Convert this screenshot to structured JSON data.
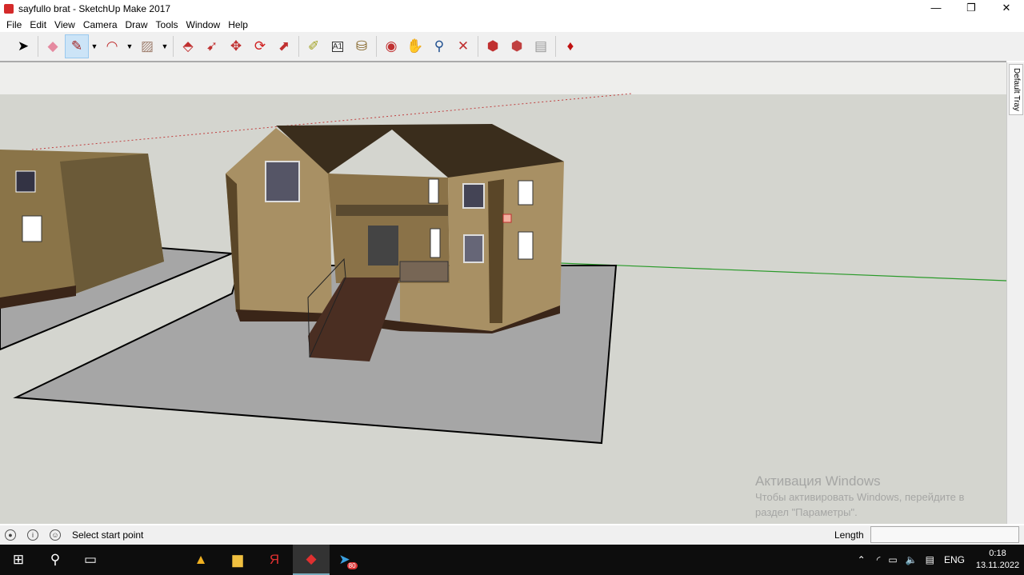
{
  "window": {
    "title": "sayfullo brat - SketchUp Make 2017",
    "minimize": "—",
    "restore": "❐",
    "close": "✕"
  },
  "menu": [
    "File",
    "Edit",
    "View",
    "Camera",
    "Draw",
    "Tools",
    "Window",
    "Help"
  ],
  "toolbar": [
    {
      "name": "select-tool",
      "glyph": "➤",
      "color": "#000"
    },
    {
      "name": "eraser-tool",
      "glyph": "◆",
      "color": "#e58aa0"
    },
    {
      "name": "line-tool",
      "glyph": "✎",
      "color": "#a02020",
      "active": true,
      "dropdown": true
    },
    {
      "name": "arc-tool",
      "glyph": "◠",
      "color": "#c03030",
      "dropdown": true
    },
    {
      "name": "rectangle-tool",
      "glyph": "▨",
      "color": "#a08070",
      "dropdown": true
    },
    {
      "name": "push-pull-tool",
      "glyph": "⬘",
      "color": "#c03030"
    },
    {
      "name": "follow-me-tool",
      "glyph": "➹",
      "color": "#c03030"
    },
    {
      "name": "move-tool",
      "glyph": "✥",
      "color": "#c03030"
    },
    {
      "name": "rotate-tool",
      "glyph": "⟳",
      "color": "#d02020"
    },
    {
      "name": "scale-tool",
      "glyph": "⬈",
      "color": "#c03030"
    },
    {
      "name": "tape-measure-tool",
      "glyph": "✐",
      "color": "#a0a020"
    },
    {
      "name": "text-tool",
      "glyph": "A1",
      "color": "#333"
    },
    {
      "name": "paint-bucket-tool",
      "glyph": "⛁",
      "color": "#806020"
    },
    {
      "name": "orbit-tool",
      "glyph": "◉",
      "color": "#c03030"
    },
    {
      "name": "pan-tool",
      "glyph": "✋",
      "color": "#d0a060"
    },
    {
      "name": "zoom-tool",
      "glyph": "⚲",
      "color": "#205090"
    },
    {
      "name": "zoom-extents-tool",
      "glyph": "✕",
      "color": "#c03030"
    },
    {
      "name": "3d-warehouse",
      "glyph": "⬢",
      "color": "#c03030"
    },
    {
      "name": "extension-warehouse",
      "glyph": "⬢",
      "color": "#c04040"
    },
    {
      "name": "send-to-layout",
      "glyph": "▤",
      "color": "#999"
    },
    {
      "name": "extension-manager",
      "glyph": "♦",
      "color": "#c01010"
    }
  ],
  "tray": {
    "label": "Default Tray"
  },
  "watermark": {
    "title": "Активация Windows",
    "line1": "Чтобы активировать Windows, перейдите в",
    "line2": "раздел \"Параметры\"."
  },
  "status": {
    "message": "Select start point",
    "length_label": "Length",
    "length_value": ""
  },
  "taskbar": {
    "language": "ENG",
    "time": "0:18",
    "date": "13.11.2022",
    "telegram_badge": "80"
  }
}
